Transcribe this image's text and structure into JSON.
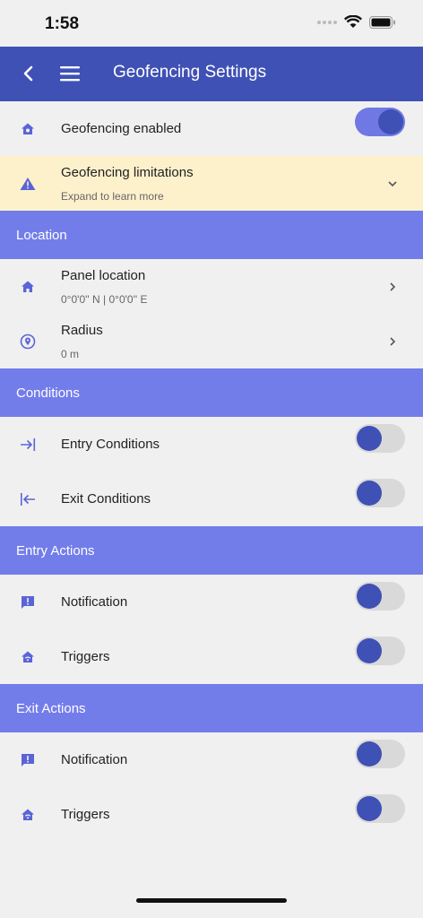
{
  "status_bar": {
    "time": "1:58"
  },
  "app_bar": {
    "title": "Geofencing Settings"
  },
  "colors": {
    "primary": "#3f51b5",
    "section": "#737dea",
    "warning_bg": "#fdf1cc",
    "icon": "#5b64d6"
  },
  "geofencing_enabled": {
    "label": "Geofencing enabled",
    "on": true
  },
  "limitations": {
    "label": "Geofencing limitations",
    "sub": "Expand to learn more"
  },
  "sections": {
    "location": "Location",
    "conditions": "Conditions",
    "entry_actions": "Entry Actions",
    "exit_actions": "Exit Actions"
  },
  "location": {
    "panel": {
      "label": "Panel location",
      "value": "0°0'0'' N | 0°0'0'' E"
    },
    "radius": {
      "label": "Radius",
      "value": "0 m"
    }
  },
  "conditions": {
    "entry": {
      "label": "Entry Conditions",
      "on": false
    },
    "exit": {
      "label": "Exit Conditions",
      "on": false
    }
  },
  "entry_actions": {
    "notification": {
      "label": "Notification",
      "on": false
    },
    "triggers": {
      "label": "Triggers",
      "on": false
    }
  },
  "exit_actions": {
    "notification": {
      "label": "Notification",
      "on": false
    },
    "triggers": {
      "label": "Triggers",
      "on": false
    }
  }
}
